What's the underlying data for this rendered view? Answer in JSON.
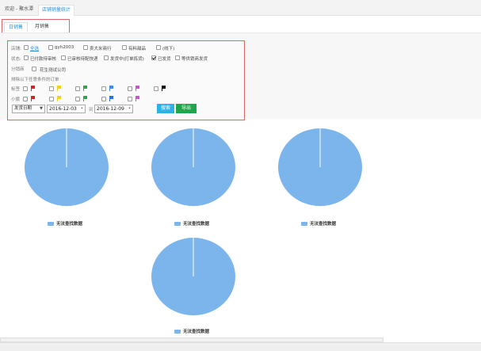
{
  "top_tabs": [
    {
      "label": "欢迎 - 聚水潭",
      "active": false
    },
    {
      "label": "店铺销量统计",
      "active": true
    }
  ],
  "sub_tabs": [
    {
      "label": "日销售",
      "active": true
    },
    {
      "label": "月销售",
      "active": false
    }
  ],
  "filters": {
    "shop_label": "店铺:",
    "shops": [
      {
        "label": "全选",
        "checked": false,
        "link": true
      },
      {
        "label": "gyh2003",
        "checked": false
      },
      {
        "label": "卖大米商行",
        "checked": false
      },
      {
        "label": "有料甜品",
        "checked": false
      },
      {
        "label": "(线下)",
        "checked": false
      }
    ],
    "status_label": "状态:",
    "statuses": [
      {
        "label": "已付款待审核",
        "checked": false
      },
      {
        "label": "已审核待配快递",
        "checked": false
      },
      {
        "label": "发货中(打单拣货)",
        "checked": false
      },
      {
        "label": "已发货",
        "checked": true
      },
      {
        "label": "等供销商发货",
        "checked": false
      }
    ],
    "distributor_label": "分销商",
    "distributors": [
      {
        "label": "花生测试公司",
        "checked": false
      }
    ],
    "exclude_note": "排除以下任意条件的订单",
    "tag_label": "标签",
    "tag_flags": [
      "#e02020",
      "#f2d21b",
      "#2aa84a",
      "#3a8ee6",
      "#d24fd2",
      "#111111"
    ],
    "flag_label": "小旗",
    "small_flags": [
      "#e02020",
      "#f2d21b",
      "#2aa84a",
      "#2f6fe0",
      "#d24fd2"
    ],
    "date_type": "发货日期",
    "date_from": "2016-12-03",
    "to_label": "到",
    "date_to": "2016-12-09",
    "search_button": "搜索",
    "export_button": "导出"
  },
  "charts": [
    {
      "legend": "无法查找数据",
      "color": "#7cb5ec"
    },
    {
      "legend": "无法查找数据",
      "color": "#7cb5ec"
    },
    {
      "legend": "无法查找数据",
      "color": "#7cb5ec"
    },
    {
      "legend": "无法查找数据",
      "color": "#7cb5ec"
    }
  ],
  "chart_data": [
    {
      "type": "pie",
      "categories": [
        "无法查找数据"
      ],
      "values": [
        100
      ]
    },
    {
      "type": "pie",
      "categories": [
        "无法查找数据"
      ],
      "values": [
        100
      ]
    },
    {
      "type": "pie",
      "categories": [
        "无法查找数据"
      ],
      "values": [
        100
      ]
    },
    {
      "type": "pie",
      "categories": [
        "无法查找数据"
      ],
      "values": [
        100
      ]
    }
  ]
}
